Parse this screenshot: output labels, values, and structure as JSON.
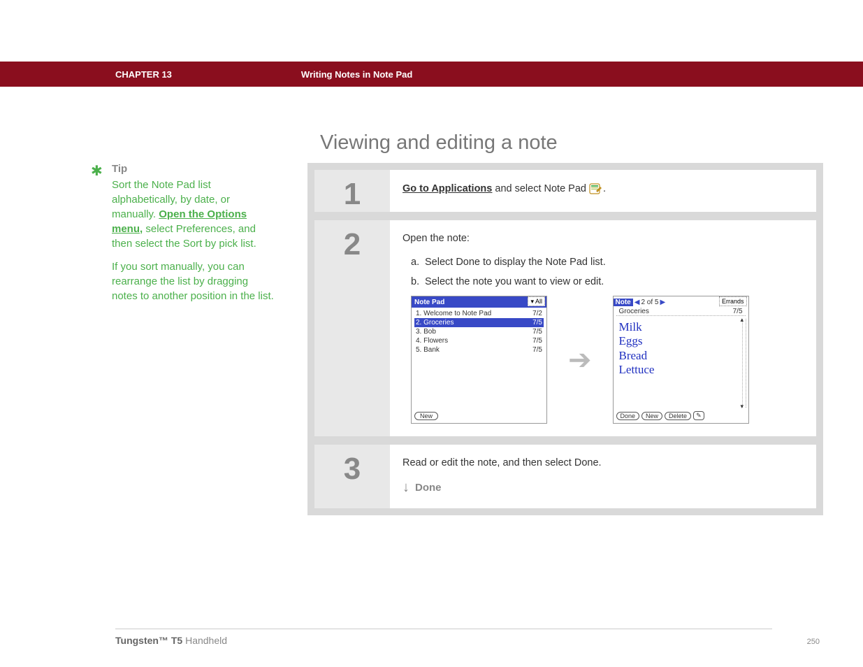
{
  "header": {
    "chapter": "CHAPTER 13",
    "breadcrumb": "Writing Notes in Note Pad"
  },
  "title": "Viewing and editing a note",
  "tip": {
    "heading": "Tip",
    "part1a": "Sort the Note Pad list alphabetically, by date, or manually. ",
    "link": "Open the Options menu,",
    "part1b": " select Preferences, and then select the Sort by pick list.",
    "part2": "If you sort manually, you can rearrange the list by dragging notes to another position in the list."
  },
  "steps": {
    "s1": {
      "num": "1",
      "link": "Go to Applications",
      "rest": " and select Note Pad ",
      "period": "."
    },
    "s2": {
      "num": "2",
      "open": "Open the note:",
      "a_letter": "a.",
      "a_text": "Select Done to display the Note Pad list.",
      "b_letter": "b.",
      "b_text": "Select the note you want to view or edit."
    },
    "s3": {
      "num": "3",
      "text": "Read or edit the note, and then select Done.",
      "done": "Done"
    }
  },
  "pda_list": {
    "title": "Note Pad",
    "cat": "▾ All",
    "items": [
      {
        "label": "1. Welcome to Note Pad",
        "date": "7/2",
        "sel": false
      },
      {
        "label": "2. Groceries",
        "date": "7/5",
        "sel": true
      },
      {
        "label": "3. Bob",
        "date": "7/5",
        "sel": false
      },
      {
        "label": "4. Flowers",
        "date": "7/5",
        "sel": false
      },
      {
        "label": "5. Bank",
        "date": "7/5",
        "sel": false
      }
    ],
    "new_btn": "New"
  },
  "pda_note": {
    "tag": "Note",
    "pager": "2 of 5",
    "cat": "Errands",
    "subtitle": "Groceries",
    "subdate": "7/5",
    "lines": [
      "Milk",
      "Eggs",
      "Bread",
      "Lettuce"
    ],
    "done": "Done",
    "new": "New",
    "delete": "Delete"
  },
  "footer": {
    "bold": "Tungsten™ T5",
    "rest": " Handheld",
    "page": "250"
  }
}
